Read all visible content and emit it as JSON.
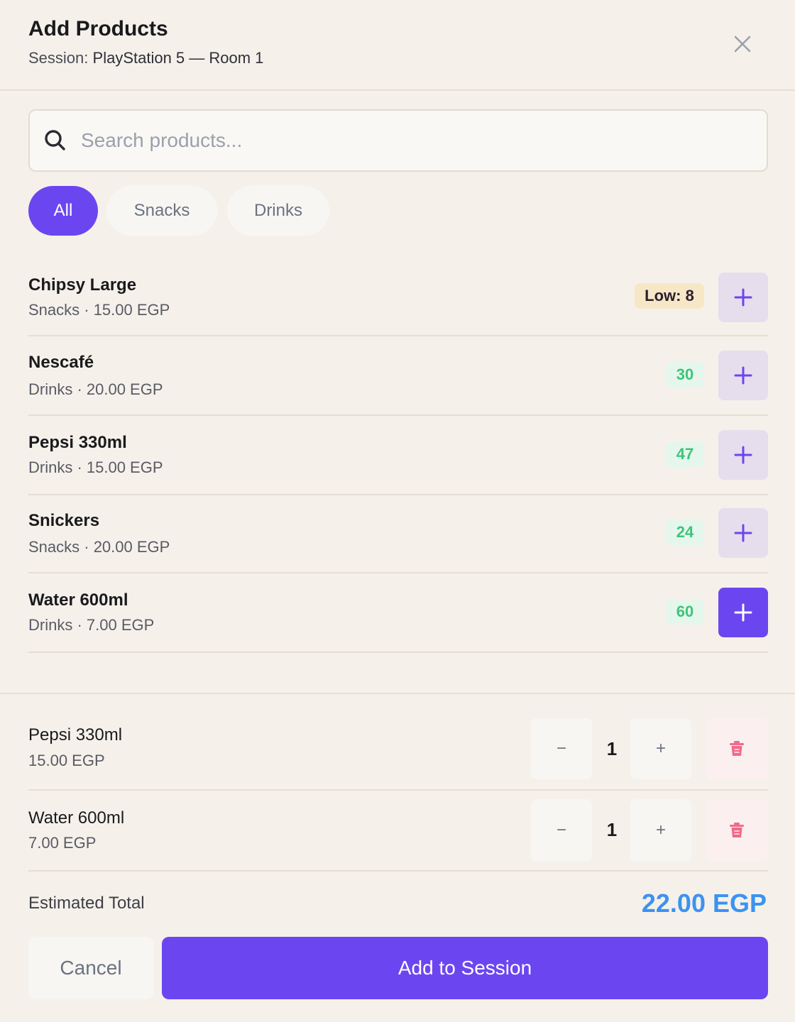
{
  "header": {
    "title": "Add Products",
    "session_label": "Session:",
    "session_value": "PlayStation 5 — Room 1"
  },
  "search": {
    "placeholder": "Search products...",
    "value": ""
  },
  "filters": [
    {
      "label": "All",
      "active": true
    },
    {
      "label": "Snacks",
      "active": false
    },
    {
      "label": "Drinks",
      "active": false
    }
  ],
  "products": [
    {
      "name": "Chipsy Large",
      "meta": "Snacks · 15.00 EGP",
      "stock": "Low: 8",
      "stock_status": "low"
    },
    {
      "name": "Nescafé",
      "meta": "Drinks · 20.00 EGP",
      "stock": "30",
      "stock_status": "ok"
    },
    {
      "name": "Pepsi 330ml",
      "meta": "Drinks · 15.00 EGP",
      "stock": "47",
      "stock_status": "ok"
    },
    {
      "name": "Snickers",
      "meta": "Snacks · 20.00 EGP",
      "stock": "24",
      "stock_status": "ok"
    },
    {
      "name": "Water 600ml",
      "meta": "Drinks · 7.00 EGP",
      "stock": "60",
      "stock_status": "ok"
    }
  ],
  "cart": [
    {
      "name": "Pepsi 330ml",
      "price": "15.00 EGP",
      "qty": "1"
    },
    {
      "name": "Water 600ml",
      "price": "7.00 EGP",
      "qty": "1"
    }
  ],
  "qty_controls": {
    "minus": "−",
    "plus": "+"
  },
  "total": {
    "label": "Estimated Total",
    "value": "22.00 EGP"
  },
  "actions": {
    "cancel": "Cancel",
    "submit": "Add to Session"
  },
  "colors": {
    "accent": "#6b46f0",
    "total": "#3b93f1",
    "low_stock_bg": "#f7e7c6",
    "ok_stock_text": "#3fc47a",
    "delete_icon": "#f06a8a",
    "background": "#f5f1ea"
  },
  "icons": {
    "close": "close-icon",
    "search": "search-icon",
    "add": "plus-icon",
    "delete": "trash-icon"
  }
}
